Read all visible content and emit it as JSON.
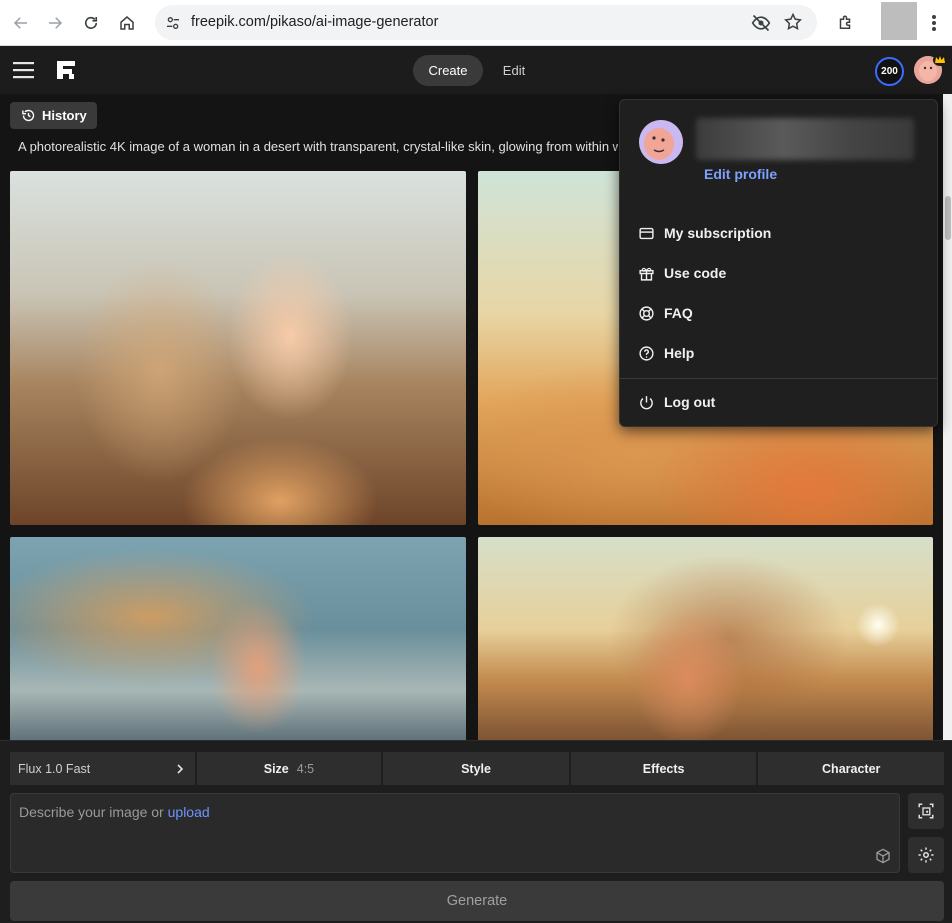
{
  "browser": {
    "url": "freepik.com/pikaso/ai-image-generator"
  },
  "header": {
    "tabs": [
      {
        "label": "Create",
        "active": true
      },
      {
        "label": "Edit",
        "active": false
      }
    ],
    "credits": "200"
  },
  "history": {
    "label": "History"
  },
  "prompt_display": "A photorealistic 4K image of a woman in a desert with transparent, crystal-like skin, glowing from within w",
  "profile_menu": {
    "edit_profile": "Edit profile",
    "items": [
      {
        "label": "My subscription",
        "icon": "card-icon"
      },
      {
        "label": "Use code",
        "icon": "gift-icon"
      },
      {
        "label": "FAQ",
        "icon": "lifebuoy-icon"
      },
      {
        "label": "Help",
        "icon": "help-circle-icon"
      }
    ],
    "logout": "Log out"
  },
  "options": {
    "model": "Flux 1.0 Fast",
    "size_label": "Size",
    "size_value": "4:5",
    "style": "Style",
    "effects": "Effects",
    "character": "Character"
  },
  "prompt_input": {
    "placeholder": "Describe your image or",
    "upload_link": "upload"
  },
  "generate_label": "Generate",
  "colors": {
    "accent": "#3d6bff",
    "link": "#6f94ff",
    "background": "#141414"
  }
}
